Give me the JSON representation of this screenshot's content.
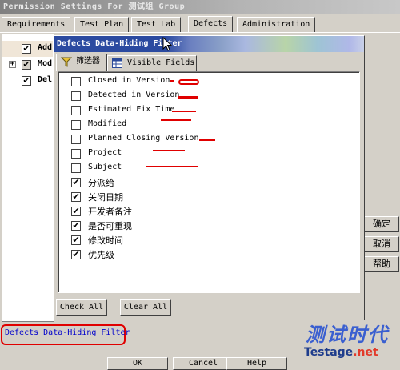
{
  "window": {
    "title": "Permission Settings For 测试组 Group"
  },
  "tabs": [
    {
      "label": "Requirements",
      "active": false
    },
    {
      "label": "Test Plan",
      "active": false
    },
    {
      "label": "Test Lab",
      "active": false
    },
    {
      "label": "Defects",
      "active": true
    },
    {
      "label": "Administration",
      "active": false
    }
  ],
  "tree": [
    {
      "label": "Add",
      "checked": true,
      "expander": ""
    },
    {
      "label": "Mod",
      "checked": true,
      "expander": "+"
    },
    {
      "label": "Del",
      "checked": true,
      "expander": ""
    }
  ],
  "side_buttons": [
    "确定",
    "取消",
    "帮助"
  ],
  "dialog": {
    "title": "Defects Data-Hiding Filter",
    "tabs": [
      {
        "label": "筛选器",
        "icon": "funnel-icon",
        "active": true
      },
      {
        "label": "Visible Fields",
        "icon": "table-icon",
        "active": false
      }
    ],
    "items": [
      {
        "label": "Closed in Version",
        "checked": false
      },
      {
        "label": "Detected in Version",
        "checked": false
      },
      {
        "label": "Estimated Fix Time",
        "checked": false
      },
      {
        "label": "Modified",
        "checked": false
      },
      {
        "label": "Planned Closing Version",
        "checked": false
      },
      {
        "label": "Project",
        "checked": false
      },
      {
        "label": "Subject",
        "checked": false
      },
      {
        "label": "分派给",
        "checked": true
      },
      {
        "label": "关闭日期",
        "checked": true
      },
      {
        "label": "开发者备注",
        "checked": true
      },
      {
        "label": "是否可重现",
        "checked": true
      },
      {
        "label": "修改时间",
        "checked": true
      },
      {
        "label": "优先级",
        "checked": true
      }
    ],
    "check_all": "Check All",
    "clear_all": "Clear All"
  },
  "footer": {
    "link": "Defects Data-Hiding Filter",
    "ok": "OK",
    "cancel": "Cancel",
    "help": "Help"
  },
  "watermark": {
    "cn": "测试时代",
    "en": "Testage",
    "en_suffix": ".net"
  },
  "colors": {
    "annotation": "#e00000",
    "title_bar": "#2b4aa0",
    "link": "#0000cc"
  }
}
